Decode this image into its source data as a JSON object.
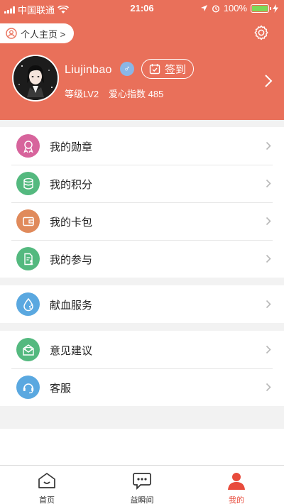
{
  "status_bar": {
    "carrier": "中国联通",
    "time": "21:06",
    "battery": "100%"
  },
  "header": {
    "homepage_label": "个人主页 >",
    "username": "Liujinbao",
    "gender_symbol": "♂",
    "checkin_label": "签到",
    "level": "等级LV2",
    "love_index": "爱心指数 485",
    "background_color": "#e9705a"
  },
  "menu_groups": [
    {
      "items": [
        {
          "label": "我的勋章",
          "icon": "medal-icon",
          "color": "#d7649c"
        },
        {
          "label": "我的积分",
          "icon": "coins-icon",
          "color": "#54b97f"
        },
        {
          "label": "我的卡包",
          "icon": "wallet-icon",
          "color": "#e08a5b"
        },
        {
          "label": "我的参与",
          "icon": "participation-icon",
          "color": "#54b97f"
        }
      ]
    },
    {
      "items": [
        {
          "label": "献血服务",
          "icon": "blood-drop-icon",
          "color": "#5aa8e0"
        }
      ]
    },
    {
      "items": [
        {
          "label": "意见建议",
          "icon": "feedback-mail-icon",
          "color": "#54b97f"
        },
        {
          "label": "客服",
          "icon": "headset-icon",
          "color": "#5aa8e0"
        }
      ]
    }
  ],
  "tab_bar": {
    "tabs": [
      {
        "label": "首页",
        "icon": "home-icon",
        "active": false
      },
      {
        "label": "益瞬间",
        "icon": "chat-icon",
        "active": false
      },
      {
        "label": "我的",
        "icon": "person-icon",
        "active": true
      }
    ],
    "active_color": "#e84b3c"
  }
}
